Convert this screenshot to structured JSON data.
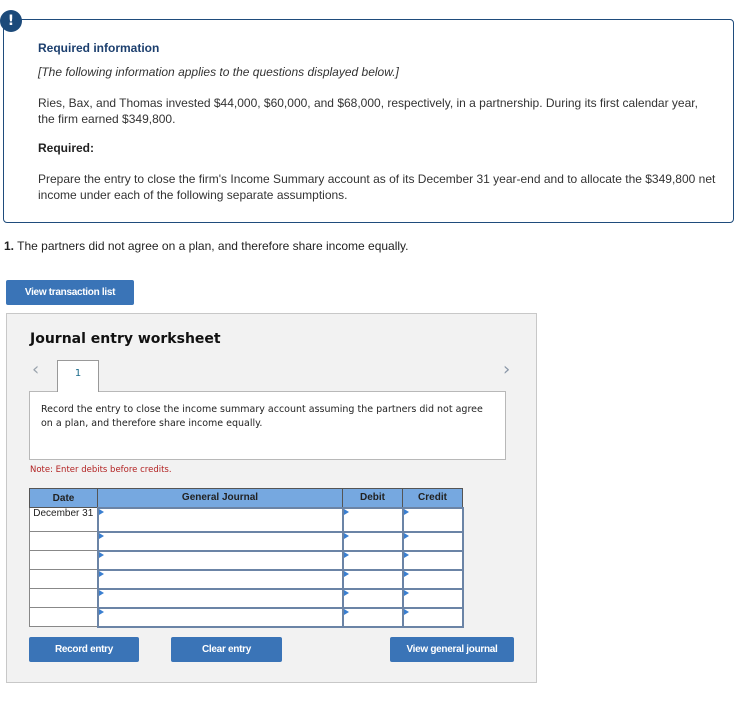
{
  "info": {
    "badge_icon": "exclamation-icon",
    "badge_text": "!",
    "title": "Required information",
    "subtitle": "[The following information applies to the questions displayed below.]",
    "body": "Ries, Bax, and Thomas invested $44,000, $60,000, and $68,000, respectively, in a partnership. During its first calendar year, the firm earned $349,800.",
    "required_label": "Required:",
    "required_text": "Prepare the entry to close the firm's Income Summary account as of its December 31 year-end and to allocate the $349,800 net income under each of the following separate assumptions."
  },
  "question": {
    "number": "1.",
    "text": " The partners did not agree on a plan, and therefore share income equally."
  },
  "buttons": {
    "view_transaction_list": "View transaction list",
    "record_entry": "Record entry",
    "clear_entry": "Clear entry",
    "view_general_journal": "View general journal"
  },
  "worksheet": {
    "title": "Journal entry worksheet",
    "prev_icon": "‹",
    "next_icon": "›",
    "tabs": [
      {
        "label": "1"
      }
    ],
    "instruction": "Record the entry to close the income summary account assuming the partners did not agree on a plan, and therefore share income equally.",
    "note": "Note: Enter debits before credits.",
    "table": {
      "headers": [
        "Date",
        "General Journal",
        "Debit",
        "Credit"
      ],
      "rows": [
        {
          "date": "December 31",
          "account": "",
          "debit": "",
          "credit": ""
        },
        {
          "date": "",
          "account": "",
          "debit": "",
          "credit": ""
        },
        {
          "date": "",
          "account": "",
          "debit": "",
          "credit": ""
        },
        {
          "date": "",
          "account": "",
          "debit": "",
          "credit": ""
        },
        {
          "date": "",
          "account": "",
          "debit": "",
          "credit": ""
        },
        {
          "date": "",
          "account": "",
          "debit": "",
          "credit": ""
        }
      ]
    }
  },
  "colors": {
    "accent": "#3a74b7",
    "info_border": "#1f4c7c",
    "table_header": "#76a8e0",
    "note": "#b22222"
  }
}
